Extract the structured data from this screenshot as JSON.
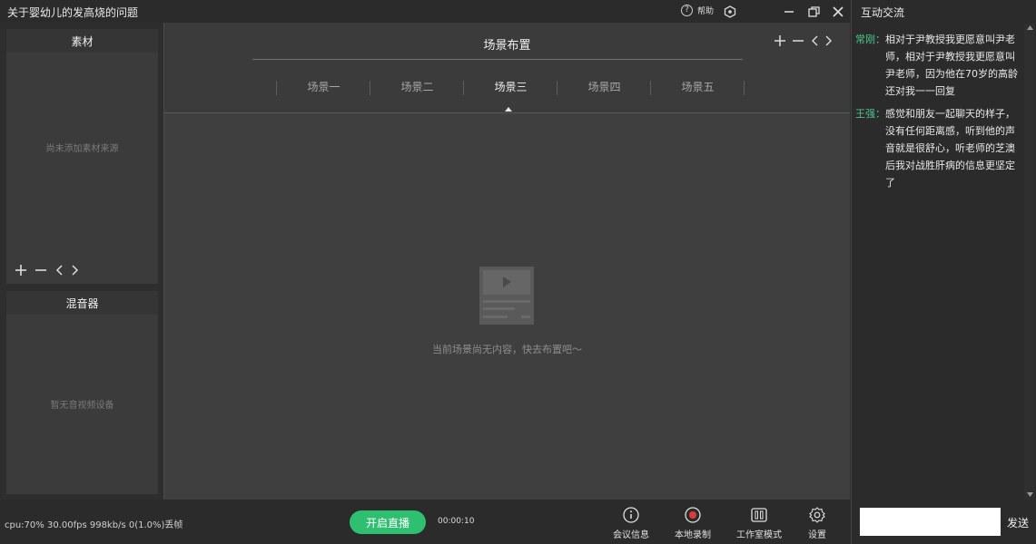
{
  "app": {
    "title": "关于婴幼儿的发高烧的问题"
  },
  "titlebar": {
    "help_label": "帮助"
  },
  "materials": {
    "title": "素材",
    "empty_text": "尚未添加素材来源"
  },
  "mixer": {
    "title": "混音器",
    "empty_text": "暂无音视频设备"
  },
  "scene": {
    "title": "场景布置",
    "tabs": [
      {
        "label": "场景一",
        "active": false
      },
      {
        "label": "场景二",
        "active": false
      },
      {
        "label": "场景三",
        "active": true
      },
      {
        "label": "场景四",
        "active": false
      },
      {
        "label": "场景五",
        "active": false
      }
    ],
    "empty_text": "当前场景尚无内容，快去布置吧～"
  },
  "chat": {
    "title": "互动交流",
    "messages": [
      {
        "name": "常刚：",
        "text": "相对于尹教授我更愿意叫尹老师，相对于尹教授我更愿意叫尹老师，因为他在70岁的高龄还对我一一回复"
      },
      {
        "name": "王强：",
        "text": "感觉和朋友一起聊天的样子，没有任何距离感，听到他的声音就是很舒心，听老师的芝澳后我对战胜肝病的信息更坚定了"
      }
    ],
    "input_value": "",
    "send_label": "发送"
  },
  "bottombar": {
    "stats": "cpu:70%   30.00fps  998kb/s  0(1.0%)丢帧",
    "live_button": "开启直播",
    "timer": "00:00:10",
    "items": [
      {
        "label": "会议信息",
        "icon": "info-icon"
      },
      {
        "label": "本地录制",
        "icon": "record-icon"
      },
      {
        "label": "工作室模式",
        "icon": "studio-icon"
      },
      {
        "label": "设置",
        "icon": "gear-icon"
      }
    ]
  },
  "colors": {
    "accent": "#2fbf71",
    "chat_name": "#4cc58d",
    "record": "#e03a3a"
  }
}
